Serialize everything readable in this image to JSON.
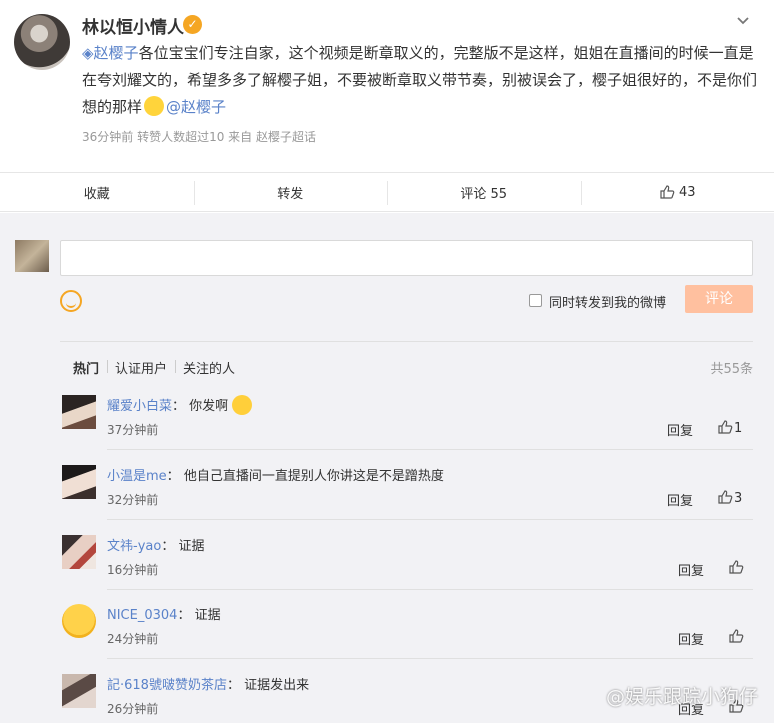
{
  "post": {
    "author": "林以恒小情人",
    "mention_prefix": "赵樱子",
    "text": "各位宝宝们专注自家，这个视频是断章取义的，完整版不是这样，姐姐在直播间的时候一直是在夸刘耀文的，希望多多了解樱子姐，不要被断章取义带节奏，别被误会了，樱子姐很好的，不是你们想的那样",
    "mention_suffix": "@赵樱子",
    "meta": "36分钟前  转赞人数超过10  来自 赵樱子超话"
  },
  "actions": {
    "favorite": "收藏",
    "repost": "转发",
    "comment": "评论 55",
    "like_count": "43"
  },
  "composer": {
    "repost_option": "同时转发到我的微博",
    "submit": "评论"
  },
  "filters": {
    "tabs": [
      "热门",
      "认证用户",
      "关注的人"
    ],
    "total": "共55条"
  },
  "comments": [
    {
      "user": "耀爱小白菜",
      "sep": "：",
      "text": "你发啊",
      "time": "37分钟前",
      "reply": "回复",
      "likes": "1"
    },
    {
      "user": "小温是me",
      "sep": "：",
      "text": "他自己直播间一直提别人你讲这是不是蹭热度",
      "time": "32分钟前",
      "reply": "回复",
      "likes": "3"
    },
    {
      "user": "文祎-yao",
      "sep": "：",
      "text": "证据",
      "time": "16分钟前",
      "reply": "回复",
      "likes": ""
    },
    {
      "user": "NICE_0304",
      "sep": "：",
      "text": "证据",
      "time": "24分钟前",
      "reply": "回复",
      "likes": ""
    },
    {
      "user": "記·618號啵赞奶茶店",
      "sep": "：",
      "text": "证据发出来",
      "time": "26分钟前",
      "reply": "回复",
      "likes": ""
    }
  ],
  "watermark": "@娱乐跟踪小狗仔"
}
